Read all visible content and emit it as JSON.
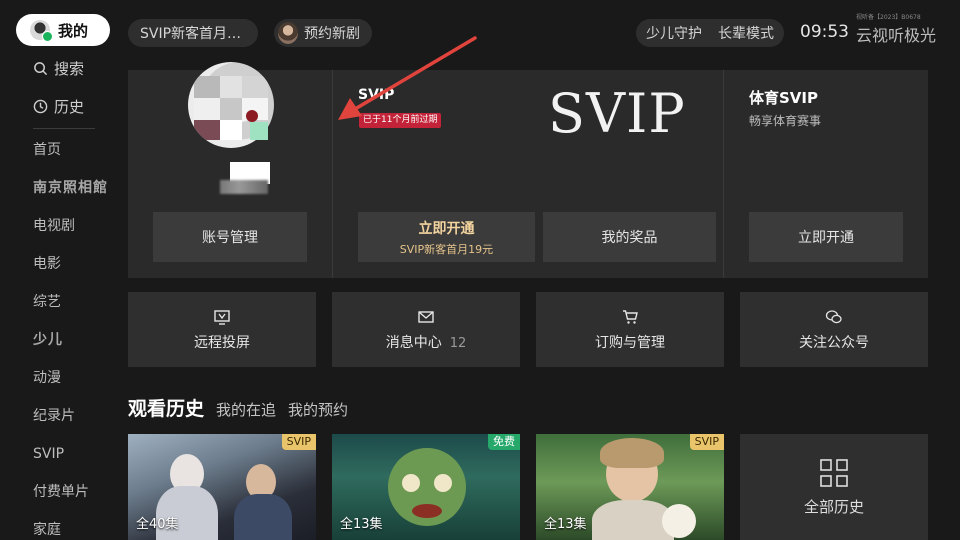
{
  "sidebar": {
    "me_label": "我的",
    "search_label": "搜索",
    "history_label": "历史",
    "nav_items": [
      "首页",
      "南京照相館",
      "电视剧",
      "电影",
      "综艺",
      "少儿",
      "动漫",
      "纪录片",
      "SVIP",
      "付费单片",
      "家庭"
    ]
  },
  "topbar": {
    "promo": "SVIP新客首月19元",
    "reserve": "预约新剧",
    "kids_guard": "少儿守护",
    "elder_mode": "长辈模式",
    "time": "09:53",
    "license": "视听备【2023】B0678",
    "brand": "云视听极光"
  },
  "account": {
    "manage_button": "账号管理",
    "svip_label": "SVIP",
    "expiry_badge": "已于11个月前过期",
    "svip_logo": "SVIP",
    "open_button_main": "立即开通",
    "open_button_sub": "SVIP新客首月19元",
    "prize_button": "我的奖品",
    "sports_title": "体育SVIP",
    "sports_subtitle": "畅享体育赛事",
    "sports_button": "立即开通"
  },
  "tiles": {
    "remote": "远程投屏",
    "messages": "消息中心",
    "messages_count": "12",
    "orders": "订购与管理",
    "wechat": "关注公众号"
  },
  "history": {
    "tab_active": "观看历史",
    "tab_following": "我的在追",
    "tab_reserved": "我的预约",
    "items": [
      {
        "badge": "SVIP",
        "episodes": "全40集"
      },
      {
        "badge": "免费",
        "episodes": "全13集"
      },
      {
        "badge": "SVIP",
        "episodes": "全13集"
      }
    ],
    "all_label": "全部历史"
  },
  "colors": {
    "background": "#191919",
    "card": "#2a2a2a",
    "svip_gold": "#f3d39e",
    "expiry_red": "#c32338",
    "free_green": "#26a86b",
    "arrow_red": "#e0443c"
  }
}
